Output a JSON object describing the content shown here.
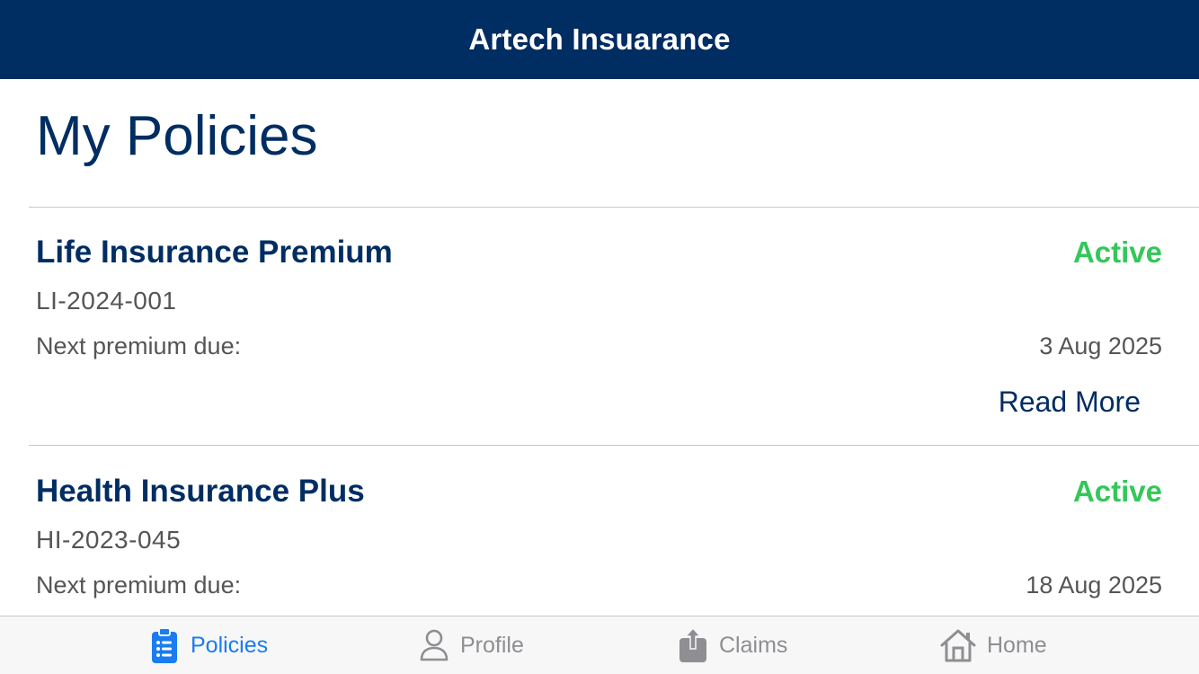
{
  "app": {
    "title": "Artech Insuarance",
    "colors": {
      "brand": "#002d62",
      "status_active": "#34c759",
      "tab_active": "#1a7cf0",
      "tab_inactive": "#8e8e93"
    }
  },
  "main": {
    "page_title": "My Policies",
    "policies": [
      {
        "name": "Life Insurance Premium",
        "status": "Active",
        "number": "LI-2024-001",
        "due_label": "Next premium due:",
        "due_date": "3 Aug 2025",
        "read_more": "Read More"
      },
      {
        "name": "Health Insurance Plus",
        "status": "Active",
        "number": "HI-2023-045",
        "due_label": "Next premium due:",
        "due_date": "18 Aug 2025"
      }
    ]
  },
  "tab_bar": {
    "tabs": [
      {
        "label": "Policies",
        "icon": "clipboard-list-icon",
        "active": true
      },
      {
        "label": "Profile",
        "icon": "person-icon",
        "active": false
      },
      {
        "label": "Claims",
        "icon": "share-upload-icon",
        "active": false
      },
      {
        "label": "Home",
        "icon": "house-icon",
        "active": false
      }
    ]
  }
}
